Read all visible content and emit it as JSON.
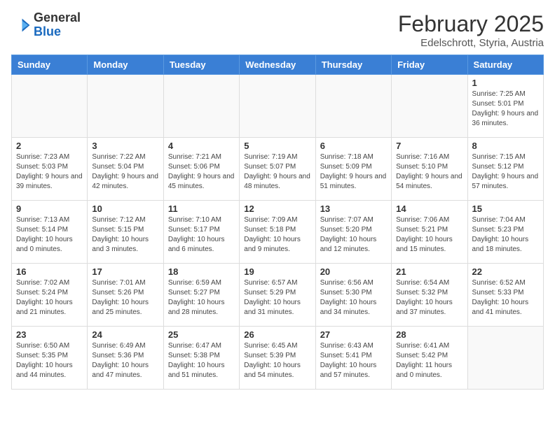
{
  "header": {
    "logo_general": "General",
    "logo_blue": "Blue",
    "month": "February 2025",
    "location": "Edelschrott, Styria, Austria"
  },
  "weekdays": [
    "Sunday",
    "Monday",
    "Tuesday",
    "Wednesday",
    "Thursday",
    "Friday",
    "Saturday"
  ],
  "weeks": [
    [
      {
        "day": "",
        "info": ""
      },
      {
        "day": "",
        "info": ""
      },
      {
        "day": "",
        "info": ""
      },
      {
        "day": "",
        "info": ""
      },
      {
        "day": "",
        "info": ""
      },
      {
        "day": "",
        "info": ""
      },
      {
        "day": "1",
        "info": "Sunrise: 7:25 AM\nSunset: 5:01 PM\nDaylight: 9 hours and 36 minutes."
      }
    ],
    [
      {
        "day": "2",
        "info": "Sunrise: 7:23 AM\nSunset: 5:03 PM\nDaylight: 9 hours and 39 minutes."
      },
      {
        "day": "3",
        "info": "Sunrise: 7:22 AM\nSunset: 5:04 PM\nDaylight: 9 hours and 42 minutes."
      },
      {
        "day": "4",
        "info": "Sunrise: 7:21 AM\nSunset: 5:06 PM\nDaylight: 9 hours and 45 minutes."
      },
      {
        "day": "5",
        "info": "Sunrise: 7:19 AM\nSunset: 5:07 PM\nDaylight: 9 hours and 48 minutes."
      },
      {
        "day": "6",
        "info": "Sunrise: 7:18 AM\nSunset: 5:09 PM\nDaylight: 9 hours and 51 minutes."
      },
      {
        "day": "7",
        "info": "Sunrise: 7:16 AM\nSunset: 5:10 PM\nDaylight: 9 hours and 54 minutes."
      },
      {
        "day": "8",
        "info": "Sunrise: 7:15 AM\nSunset: 5:12 PM\nDaylight: 9 hours and 57 minutes."
      }
    ],
    [
      {
        "day": "9",
        "info": "Sunrise: 7:13 AM\nSunset: 5:14 PM\nDaylight: 10 hours and 0 minutes."
      },
      {
        "day": "10",
        "info": "Sunrise: 7:12 AM\nSunset: 5:15 PM\nDaylight: 10 hours and 3 minutes."
      },
      {
        "day": "11",
        "info": "Sunrise: 7:10 AM\nSunset: 5:17 PM\nDaylight: 10 hours and 6 minutes."
      },
      {
        "day": "12",
        "info": "Sunrise: 7:09 AM\nSunset: 5:18 PM\nDaylight: 10 hours and 9 minutes."
      },
      {
        "day": "13",
        "info": "Sunrise: 7:07 AM\nSunset: 5:20 PM\nDaylight: 10 hours and 12 minutes."
      },
      {
        "day": "14",
        "info": "Sunrise: 7:06 AM\nSunset: 5:21 PM\nDaylight: 10 hours and 15 minutes."
      },
      {
        "day": "15",
        "info": "Sunrise: 7:04 AM\nSunset: 5:23 PM\nDaylight: 10 hours and 18 minutes."
      }
    ],
    [
      {
        "day": "16",
        "info": "Sunrise: 7:02 AM\nSunset: 5:24 PM\nDaylight: 10 hours and 21 minutes."
      },
      {
        "day": "17",
        "info": "Sunrise: 7:01 AM\nSunset: 5:26 PM\nDaylight: 10 hours and 25 minutes."
      },
      {
        "day": "18",
        "info": "Sunrise: 6:59 AM\nSunset: 5:27 PM\nDaylight: 10 hours and 28 minutes."
      },
      {
        "day": "19",
        "info": "Sunrise: 6:57 AM\nSunset: 5:29 PM\nDaylight: 10 hours and 31 minutes."
      },
      {
        "day": "20",
        "info": "Sunrise: 6:56 AM\nSunset: 5:30 PM\nDaylight: 10 hours and 34 minutes."
      },
      {
        "day": "21",
        "info": "Sunrise: 6:54 AM\nSunset: 5:32 PM\nDaylight: 10 hours and 37 minutes."
      },
      {
        "day": "22",
        "info": "Sunrise: 6:52 AM\nSunset: 5:33 PM\nDaylight: 10 hours and 41 minutes."
      }
    ],
    [
      {
        "day": "23",
        "info": "Sunrise: 6:50 AM\nSunset: 5:35 PM\nDaylight: 10 hours and 44 minutes."
      },
      {
        "day": "24",
        "info": "Sunrise: 6:49 AM\nSunset: 5:36 PM\nDaylight: 10 hours and 47 minutes."
      },
      {
        "day": "25",
        "info": "Sunrise: 6:47 AM\nSunset: 5:38 PM\nDaylight: 10 hours and 51 minutes."
      },
      {
        "day": "26",
        "info": "Sunrise: 6:45 AM\nSunset: 5:39 PM\nDaylight: 10 hours and 54 minutes."
      },
      {
        "day": "27",
        "info": "Sunrise: 6:43 AM\nSunset: 5:41 PM\nDaylight: 10 hours and 57 minutes."
      },
      {
        "day": "28",
        "info": "Sunrise: 6:41 AM\nSunset: 5:42 PM\nDaylight: 11 hours and 0 minutes."
      },
      {
        "day": "",
        "info": ""
      }
    ]
  ]
}
